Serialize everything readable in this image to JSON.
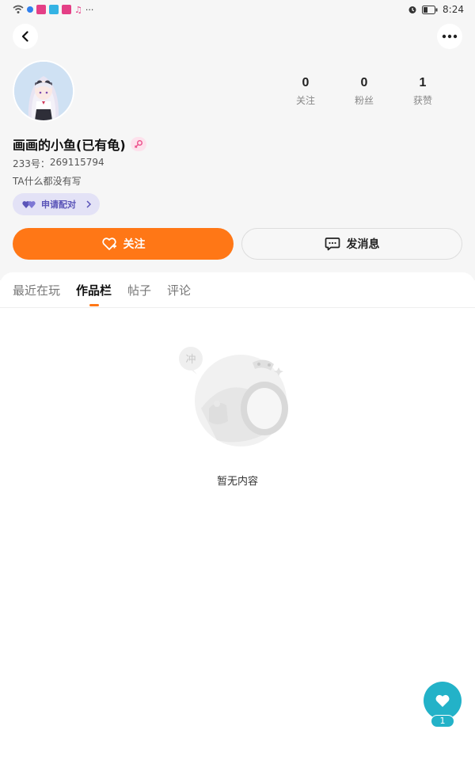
{
  "status_bar": {
    "time": "8:24"
  },
  "profile": {
    "username": "画画的小鱼(已有龟)",
    "uid_label": "233号：",
    "uid": "269115794",
    "bio": "TA什么都没有写"
  },
  "stats": [
    {
      "value": "0",
      "label": "关注"
    },
    {
      "value": "0",
      "label": "粉丝"
    },
    {
      "value": "1",
      "label": "获赞"
    }
  ],
  "buttons": {
    "pair": "申请配对",
    "follow": "关注",
    "message": "发消息"
  },
  "tabs": [
    {
      "label": "最近在玩",
      "active": false
    },
    {
      "label": "作品栏",
      "active": true
    },
    {
      "label": "帖子",
      "active": false
    },
    {
      "label": "评论",
      "active": false
    }
  ],
  "empty_state": {
    "bubble_text": "冲",
    "message": "暂无内容"
  },
  "like_fab": {
    "count": "1"
  },
  "colors": {
    "accent": "#ff7716",
    "teal": "#23b2c8",
    "purple": "#5a54b8"
  }
}
